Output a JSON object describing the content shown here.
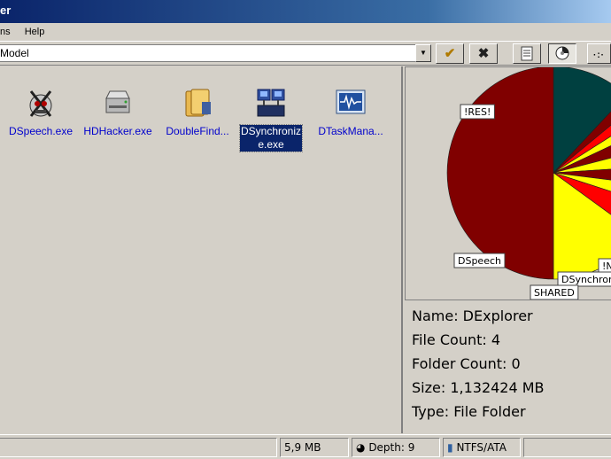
{
  "window": {
    "title": "er"
  },
  "menu": {
    "items": [
      "ns",
      "Help"
    ]
  },
  "toolbar": {
    "address": "Model",
    "ok_glyph": "✔",
    "cancel_glyph": "✖"
  },
  "files": [
    {
      "name": "DSpeech.exe",
      "icon": "dspeech-app-icon"
    },
    {
      "name": "HDHacker.exe",
      "icon": "hard-drive-icon"
    },
    {
      "name": "DoubleFind...",
      "icon": "folder-search-icon"
    },
    {
      "name": "DSynchronize.exe",
      "display": "DSynchroniz\ne.exe",
      "icon": "sync-app-icon",
      "selected": true
    },
    {
      "name": "DTaskMana...",
      "icon": "task-manager-icon"
    }
  ],
  "chart_data": {
    "type": "pie",
    "slices": [
      {
        "label": "",
        "value": 12,
        "color": "#004040"
      },
      {
        "label": "",
        "value": 2,
        "color": "#800000"
      },
      {
        "label": "",
        "value": 2,
        "color": "#ff0000"
      },
      {
        "label": "",
        "value": 2,
        "color": "#ffff00"
      },
      {
        "label": "!N",
        "value": 3,
        "color": "#800000"
      },
      {
        "label": "DSynchron",
        "value": 3,
        "color": "#ffff00"
      },
      {
        "label": "",
        "value": 3,
        "color": "#800000"
      },
      {
        "label": "",
        "value": 3,
        "color": "#ffff00"
      },
      {
        "label": "SHARED",
        "value": 5,
        "color": "#ff0000"
      },
      {
        "label": "DSpeech",
        "value": 15,
        "color": "#ffff00"
      },
      {
        "label": "!RES!",
        "value": 50,
        "color": "#800000"
      }
    ]
  },
  "info": {
    "name": "Name: DExplorer",
    "file_count": "File Count: 4",
    "folder_count": "Folder Count: 0",
    "size": "Size: 1,132424 MB",
    "type": "Type: File Folder"
  },
  "status": {
    "size": "5,9 MB",
    "depth": "Depth: 9",
    "fs": "NTFS/ATA"
  }
}
